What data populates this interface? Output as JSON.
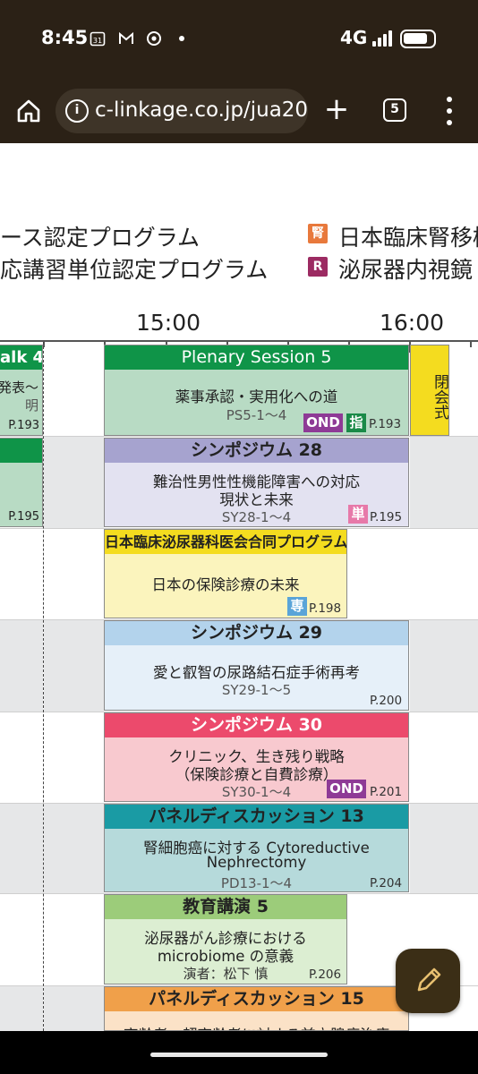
{
  "status": {
    "time": "8:45",
    "icons": [
      "calendar-31-icon",
      "gmail-icon",
      "chrome-icon",
      "dot-icon"
    ],
    "calendar_glyph": "31",
    "network": "4G",
    "battery_level": 0.85
  },
  "browser": {
    "url": "c-linkage.co.jp/jua20",
    "tab_count": "5"
  },
  "legend": {
    "item1": "ース認定プログラム",
    "item2": "応講習単位認定プログラム",
    "item3": {
      "badge": "腎",
      "color": "#e8793c",
      "text": "日本臨床腎移植"
    },
    "item4": {
      "badge": "R",
      "color": "#9c2b62",
      "text": "泌尿器内視鏡"
    }
  },
  "timeline": {
    "labels": [
      "15:00",
      "16:00"
    ]
  },
  "sessions": {
    "left_top": {
      "title": "alk 4",
      "line1": "発表～",
      "line2": "明",
      "page": "P.193",
      "color": "#0f9448"
    },
    "left_mid": {
      "page": "P.195",
      "color": "#0f9448"
    },
    "ps5": {
      "title": "Plenary Session 5",
      "line1": "薬事承認・実用化への道",
      "code": "PS5-1～4",
      "badges": [
        "OND",
        "指"
      ],
      "page": "P.193",
      "header_color": "#0f9448",
      "body_color": "#b8dbc4"
    },
    "closing": {
      "label": "閉会式",
      "color": "#f4dc1f"
    },
    "sy28": {
      "title": "シンポジウム 28",
      "line1": "難治性男性性機能障害への対応",
      "line2": "現状と未来",
      "code": "SY28-1～4",
      "badge": "単",
      "page": "P.195",
      "header_color": "#a6a3cf",
      "body_color": "#e3e2f1"
    },
    "joint": {
      "title": "日本臨床泌尿器科医会合同プログラム",
      "line1": "日本の保険診療の未来",
      "badge": "専",
      "page": "P.198",
      "header_color": "#f4dc1f",
      "body_color": "#fbf4bd"
    },
    "sy29": {
      "title": "シンポジウム 29",
      "line1": "愛と叡智の尿路結石症手術再考",
      "code": "SY29-1～5",
      "page": "P.200",
      "header_color": "#b3d3ec",
      "body_color": "#e6f0f9"
    },
    "sy30": {
      "title": "シンポジウム 30",
      "line1": "クリニック、生き残り戦略",
      "line2": "（保険診療と自費診療）",
      "code": "SY30-1～4",
      "badge": "OND",
      "page": "P.201",
      "header_color": "#ec4a6c",
      "body_color": "#f8c9cf"
    },
    "pd13": {
      "title": "パネルディスカッション 13",
      "line1": "腎細胞癌に対する Cytoreductive",
      "line2": "Nephrectomy",
      "code": "PD13-1～4",
      "page": "P.204",
      "header_color": "#1a9ba4",
      "body_color": "#b6dadb"
    },
    "edu5": {
      "title": "教育講演 5",
      "line1": "泌尿器がん診療における",
      "line2": "microbiome の意義",
      "code": "演者：松下 慎",
      "page": "P.206",
      "header_color": "#9ccc7a",
      "body_color": "#dceed2"
    },
    "pd15": {
      "title": "パネルディスカッション 15",
      "line1": "高齢者・超高齢者に対する前立腺癌治療",
      "header_color": "#f0a04a",
      "body_color": "#fbe2c7"
    }
  },
  "badge_colors": {
    "OND": "#8e3a96",
    "指": "#1a8a48",
    "単": "#e779a9",
    "専": "#5aa4d8"
  },
  "fab": {
    "icon": "pencil-icon",
    "color": "#3b2e16"
  }
}
